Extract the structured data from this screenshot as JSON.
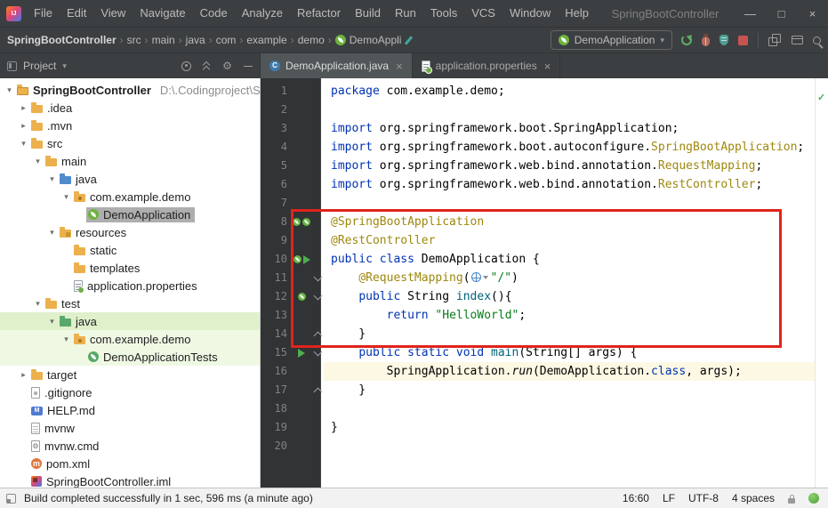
{
  "window": {
    "title": "SpringBootController"
  },
  "menu_bar": {
    "items": [
      "File",
      "Edit",
      "View",
      "Navigate",
      "Code",
      "Analyze",
      "Refactor",
      "Build",
      "Run",
      "Tools",
      "VCS",
      "Window",
      "Help"
    ]
  },
  "navigation_bar": {
    "breadcrumbs": [
      {
        "label": "SpringBootController",
        "bold": true
      },
      {
        "label": "src"
      },
      {
        "label": "main"
      },
      {
        "label": "java"
      },
      {
        "label": "com"
      },
      {
        "label": "example"
      },
      {
        "label": "demo"
      },
      {
        "label": "DemoAppli",
        "icon": "spring"
      }
    ],
    "run_config_label": "DemoApplication",
    "run_actions": [
      "rerun",
      "debug",
      "coverage",
      "stop"
    ],
    "right_icons": [
      "folders",
      "window",
      "search"
    ]
  },
  "project_panel": {
    "title": "Project",
    "header_icons": [
      "locate",
      "collapse-all",
      "settings",
      "hide"
    ],
    "tree": [
      {
        "label": "SpringBootController",
        "detail": "D:\\.Codingproject\\S",
        "depth": 0,
        "icon": "project",
        "chevron": "down",
        "bold": true
      },
      {
        "label": ".idea",
        "depth": 1,
        "icon": "folder",
        "chevron": "right"
      },
      {
        "label": ".mvn",
        "depth": 1,
        "icon": "folder",
        "chevron": "right"
      },
      {
        "label": "src",
        "depth": 1,
        "icon": "folder",
        "chevron": "down"
      },
      {
        "label": "main",
        "depth": 2,
        "icon": "folder",
        "chevron": "down"
      },
      {
        "label": "java",
        "depth": 3,
        "icon": "folder-source",
        "chevron": "down"
      },
      {
        "label": "com.example.demo",
        "depth": 4,
        "icon": "package",
        "chevron": "down"
      },
      {
        "label": "DemoApplication",
        "depth": 5,
        "icon": "spring-class",
        "selected": true
      },
      {
        "label": "resources",
        "depth": 3,
        "icon": "folder-resources",
        "chevron": "down"
      },
      {
        "label": "static",
        "depth": 4,
        "icon": "folder"
      },
      {
        "label": "templates",
        "depth": 4,
        "icon": "folder"
      },
      {
        "label": "application.properties",
        "depth": 4,
        "icon": "properties-file"
      },
      {
        "label": "test",
        "depth": 2,
        "icon": "folder",
        "chevron": "down"
      },
      {
        "label": "java",
        "depth": 3,
        "icon": "folder-test",
        "chevron": "down",
        "highlight": "strong"
      },
      {
        "label": "com.example.demo",
        "depth": 4,
        "icon": "package",
        "chevron": "down",
        "highlight": "light"
      },
      {
        "label": "DemoApplicationTests",
        "depth": 5,
        "icon": "spring-test-class",
        "highlight": "light"
      },
      {
        "label": "target",
        "depth": 1,
        "icon": "folder",
        "chevron": "right"
      },
      {
        "label": ".gitignore",
        "depth": 1,
        "icon": "ignore-file"
      },
      {
        "label": "HELP.md",
        "depth": 1,
        "icon": "markdown-file"
      },
      {
        "label": "mvnw",
        "depth": 1,
        "icon": "text-file"
      },
      {
        "label": "mvnw.cmd",
        "depth": 1,
        "icon": "cmd-file"
      },
      {
        "label": "pom.xml",
        "depth": 1,
        "icon": "maven-file"
      },
      {
        "label": "SpringBootController.iml",
        "depth": 1,
        "icon": "iml-file"
      }
    ]
  },
  "editor_tabs": [
    {
      "label": "DemoApplication.java",
      "icon": "java-class",
      "active": true,
      "closable": true
    },
    {
      "label": "application.properties",
      "icon": "properties-file",
      "active": false,
      "closable": true
    }
  ],
  "editor": {
    "lines": [
      {
        "n": 1,
        "tokens": [
          [
            "kw",
            "package"
          ],
          [
            "pl",
            " com.example.demo;"
          ]
        ]
      },
      {
        "n": 2,
        "tokens": []
      },
      {
        "n": 3,
        "tokens": [
          [
            "kw",
            "import"
          ],
          [
            "pl",
            " org.springframework.boot.SpringApplication;"
          ]
        ]
      },
      {
        "n": 4,
        "tokens": [
          [
            "kw",
            "import"
          ],
          [
            "pl",
            " org.springframework.boot.autoconfigure."
          ],
          [
            "ann",
            "SpringBootApplication"
          ],
          [
            "pl",
            ";"
          ]
        ]
      },
      {
        "n": 5,
        "tokens": [
          [
            "kw",
            "import"
          ],
          [
            "pl",
            " org.springframework.web.bind.annotation."
          ],
          [
            "ann",
            "RequestMapping"
          ],
          [
            "pl",
            ";"
          ]
        ]
      },
      {
        "n": 6,
        "tokens": [
          [
            "kw",
            "import"
          ],
          [
            "pl",
            " org.springframework.web.bind.annotation."
          ],
          [
            "ann",
            "RestController"
          ],
          [
            "pl",
            ";"
          ]
        ]
      },
      {
        "n": 7,
        "tokens": []
      },
      {
        "n": 8,
        "gutter": [
          "bean",
          "bean"
        ],
        "tokens": [
          [
            "ann",
            "@SpringBootApplication"
          ]
        ]
      },
      {
        "n": 9,
        "tokens": [
          [
            "ann",
            "@RestController"
          ]
        ]
      },
      {
        "n": 10,
        "gutter": [
          "bean",
          "run"
        ],
        "tokens": [
          [
            "kw",
            "public class"
          ],
          [
            "pl",
            " DemoApplication {"
          ]
        ]
      },
      {
        "n": 11,
        "fold": "down",
        "tokens": [
          [
            "pl",
            "    "
          ],
          [
            "ann",
            "@RequestMapping"
          ],
          [
            "pl",
            "("
          ],
          [
            "inlay",
            ""
          ],
          [
            "str",
            "\"/\""
          ],
          [
            "pl",
            ")"
          ]
        ]
      },
      {
        "n": 12,
        "gutter": [
          "bean"
        ],
        "fold": "down",
        "tokens": [
          [
            "pl",
            "    "
          ],
          [
            "kw",
            "public"
          ],
          [
            "pl",
            " String "
          ],
          [
            "decl",
            "index"
          ],
          [
            "pl",
            "(){"
          ]
        ]
      },
      {
        "n": 13,
        "tokens": [
          [
            "pl",
            "        "
          ],
          [
            "kw",
            "return"
          ],
          [
            "pl",
            " "
          ],
          [
            "str",
            "\"HelloWorld\""
          ],
          [
            "pl",
            ";"
          ]
        ]
      },
      {
        "n": 14,
        "fold": "up",
        "tokens": [
          [
            "pl",
            "    }"
          ]
        ]
      },
      {
        "n": 15,
        "gutter": [
          "run"
        ],
        "fold": "down",
        "tokens": [
          [
            "pl",
            "    "
          ],
          [
            "kw",
            "public static void"
          ],
          [
            "pl",
            " "
          ],
          [
            "decl",
            "main"
          ],
          [
            "pl",
            "(String[] args) {"
          ]
        ]
      },
      {
        "n": 16,
        "current": true,
        "tokens": [
          [
            "pl",
            "        SpringApplication."
          ],
          [
            "call",
            "run"
          ],
          [
            "pl",
            "(DemoApplication."
          ],
          [
            "kw",
            "class"
          ],
          [
            "pl",
            ", args);"
          ]
        ]
      },
      {
        "n": 17,
        "fold": "up",
        "tokens": [
          [
            "pl",
            "    }"
          ]
        ]
      },
      {
        "n": 18,
        "tokens": []
      },
      {
        "n": 19,
        "tokens": [
          [
            "pl",
            "}"
          ]
        ]
      },
      {
        "n": 20,
        "tokens": []
      }
    ]
  },
  "annotation": {
    "color": "#e0241b"
  },
  "status_bar": {
    "message": "Build completed successfully in 1 sec, 596 ms (a minute ago)",
    "caret_position": "16:60",
    "line_separator": "LF",
    "encoding": "UTF-8",
    "indent": "4 spaces"
  },
  "colors": {
    "chrome_bg": "#3c3f41",
    "gutter_bg": "#313335",
    "keyword_blue": "#0033b3",
    "annotation_olive": "#9e880d",
    "string_green": "#067d17",
    "method_teal": "#00627a",
    "spring_green": "#6db33f",
    "annotation_red": "#e0241b",
    "selection_gray": "#aeaeae",
    "test_scope_green": "#dff0cb",
    "current_line": "#fcf8e3"
  }
}
